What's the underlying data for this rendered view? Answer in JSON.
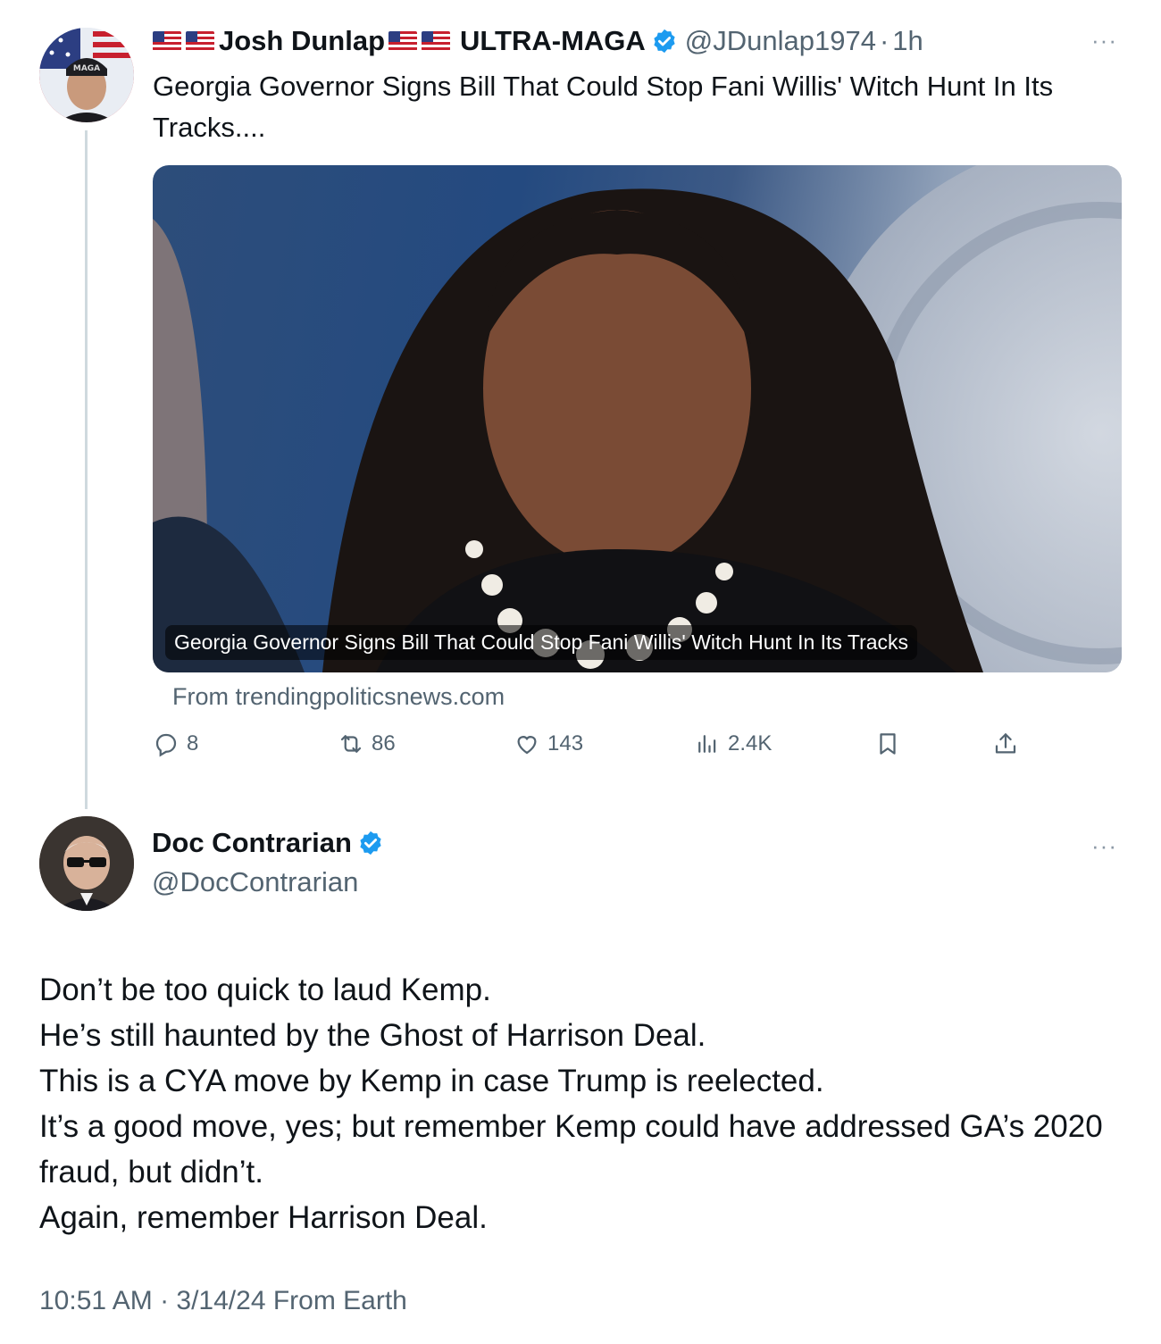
{
  "parent_tweet": {
    "name_prefix": "",
    "name": "Josh Dunlap",
    "name_suffix": "ULTRA-MAGA",
    "handle": "@JDunlap1974",
    "time": "1h",
    "more": "···",
    "avatar_text": "MAGA",
    "text": "Georgia Governor Signs Bill That Could Stop Fani Willis' Witch Hunt In Its Tracks....",
    "card": {
      "caption": "Georgia Governor Signs Bill That Could Stop Fani Willis' Witch Hunt In Its Tracks",
      "source": "From trendingpoliticsnews.com"
    },
    "actions": {
      "replies": "8",
      "reposts": "86",
      "likes": "143",
      "views": "2.4K"
    },
    "icons": [
      "reply-icon",
      "repost-icon",
      "like-icon",
      "views-icon",
      "bookmark-icon",
      "share-icon",
      "verified-icon",
      "flag-icon"
    ]
  },
  "reply_tweet": {
    "name": "Doc Contrarian",
    "handle": "@DocContrarian",
    "more": "···",
    "lines": [
      "Don’t be too quick to laud Kemp.",
      "He’s still haunted by the Ghost of Harrison Deal.",
      "This is a CYA move by Kemp in case Trump is reelected.",
      "It’s a good move, yes; but remember Kemp could have addressed GA’s 2020 fraud, but didn’t.",
      "Again, remember Harrison Deal."
    ],
    "footer": "10:51 AM · 3/14/24 From Earth"
  },
  "colors": {
    "verified": "#1d9bf0",
    "muted": "#536471",
    "text": "#0f1419"
  }
}
